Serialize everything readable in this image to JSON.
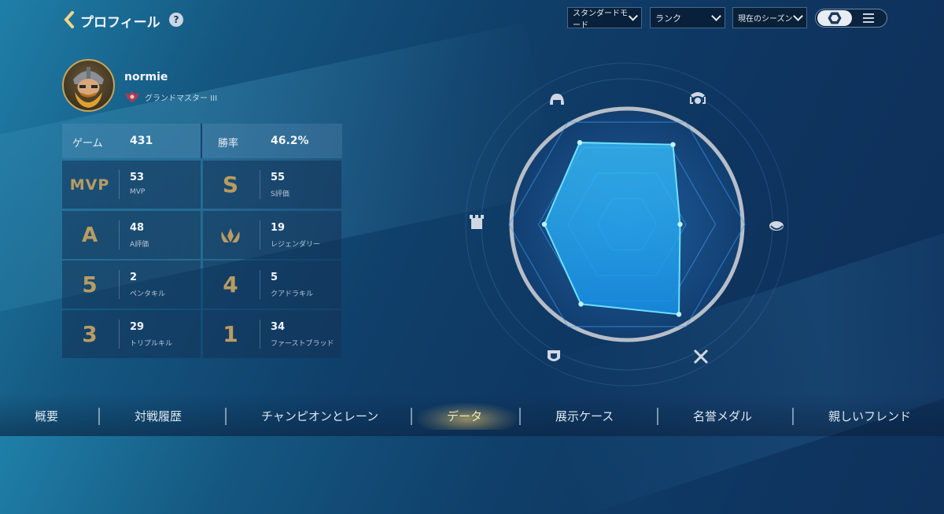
{
  "header": {
    "title": "プロフィール",
    "help": "?"
  },
  "filters": {
    "mode": "スタンダードモード",
    "rank": "ランク",
    "season": "現在のシーズン"
  },
  "profile": {
    "name": "normie",
    "rank": "グランドマスター III"
  },
  "summary": {
    "games_label": "ゲーム",
    "games_value": "431",
    "winrate_label": "勝率",
    "winrate_value": "46.2%"
  },
  "stats": [
    {
      "badge": "MVP",
      "value": "53",
      "label": "MVP"
    },
    {
      "badge": "S",
      "value": "55",
      "label": "S評価"
    },
    {
      "badge": "A",
      "value": "48",
      "label": "A評価"
    },
    {
      "badge": "",
      "value": "19",
      "label": "レジェンダリー"
    },
    {
      "badge": "5",
      "value": "2",
      "label": "ペンタキル"
    },
    {
      "badge": "4",
      "value": "5",
      "label": "クアドラキル"
    },
    {
      "badge": "3",
      "value": "29",
      "label": "トリプルキル"
    },
    {
      "badge": "1",
      "value": "34",
      "label": "ファーストブラッド"
    }
  ],
  "radar": {
    "axes": [
      "mage",
      "assassin",
      "marksman",
      "fighter",
      "tank",
      "support"
    ],
    "values": [
      0.45,
      0.78,
      0.8,
      0.7,
      0.78,
      0.88
    ]
  },
  "colors": {
    "gold": "#b99c62",
    "radar_fill": "#2fb4ff",
    "active_tab": "#f4e6b6"
  },
  "nav": {
    "tabs": [
      "概要",
      "対戦履歴",
      "チャンピオンとレーン",
      "データ",
      "展示ケース",
      "名誉メダル",
      "親しいフレンド"
    ],
    "active": "データ"
  }
}
